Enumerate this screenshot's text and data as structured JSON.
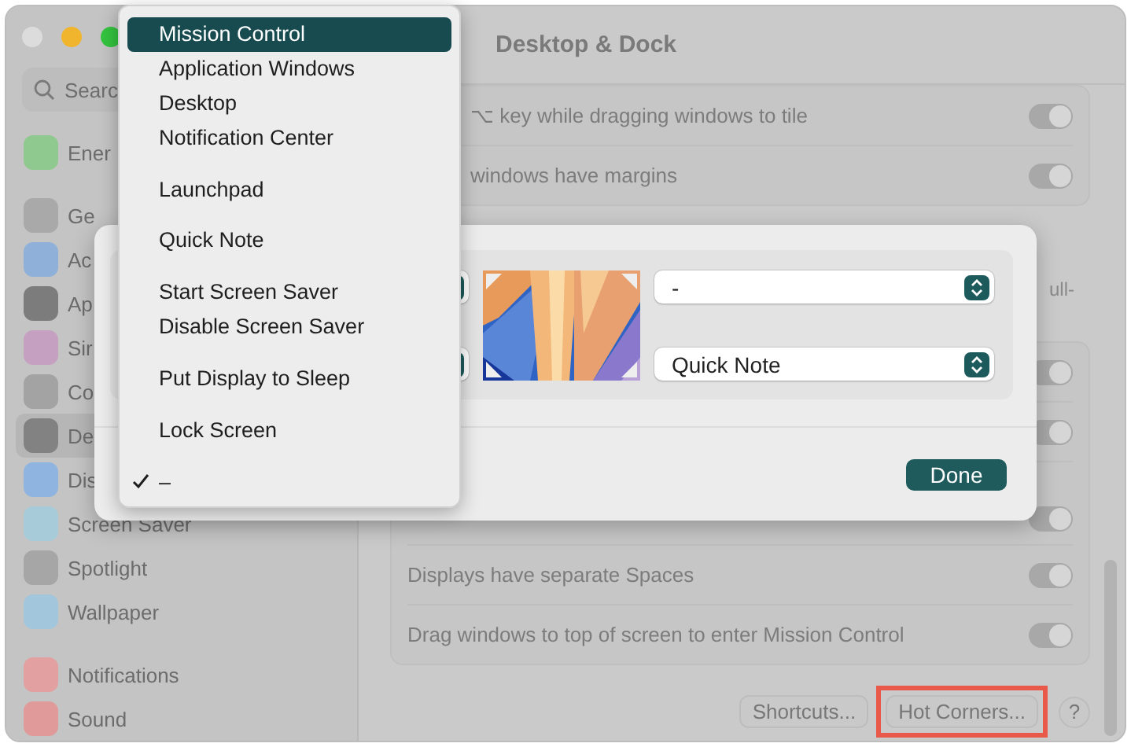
{
  "window": {
    "title": "Desktop & Dock"
  },
  "sidebar": {
    "search": {
      "placeholder": "Searc"
    },
    "groups": [
      [
        {
          "label": "Ener",
          "color": "#8fc98f",
          "selected": false
        }
      ],
      [
        {
          "label": "Ge",
          "color": "#a9a9a9",
          "selected": false
        },
        {
          "label": "Ac",
          "color": "#8fb0d8",
          "selected": false
        },
        {
          "label": "Ap",
          "color": "#7c7c7c",
          "selected": false
        },
        {
          "label": "Sir",
          "color": "#c5a0c0",
          "selected": false
        },
        {
          "label": "Co",
          "color": "#a3a3a3",
          "selected": false
        },
        {
          "label": "De",
          "color": "#828282",
          "selected": true
        },
        {
          "label": "Dis",
          "color": "#8fb4e0",
          "selected": false
        },
        {
          "label": "Screen Saver",
          "color": "#a7cbd8",
          "selected": false
        },
        {
          "label": "Spotlight",
          "color": "#a6a6a6",
          "selected": false
        },
        {
          "label": "Wallpaper",
          "color": "#a2c6dc",
          "selected": false
        }
      ],
      [
        {
          "label": "Notifications",
          "color": "#e2a0a0",
          "selected": false
        },
        {
          "label": "Sound",
          "color": "#e09a9a",
          "selected": false
        }
      ]
    ]
  },
  "settings_top": [
    {
      "label": "⌥ key while dragging windows to tile",
      "on": true
    },
    {
      "label": "windows have margins",
      "on": true
    }
  ],
  "note": "ull-",
  "settings": [
    {
      "on": true
    },
    {
      "on": true
    },
    {
      "on": true
    },
    {
      "label": "Displays have separate Spaces",
      "on": true
    },
    {
      "label": "Drag windows to top of screen to enter Mission Control",
      "on": true
    }
  ],
  "buttons": [
    {
      "label": "Shortcuts...",
      "highlighted": false
    },
    {
      "label": "Hot Corners...",
      "highlighted": true
    }
  ],
  "help": "?",
  "sheet": {
    "corners": [
      {
        "value": "-"
      },
      {
        "value": "Quick Note"
      }
    ],
    "done": "Done"
  },
  "menu": {
    "items": [
      {
        "kind": "item",
        "label": "Mission Control",
        "selected": true,
        "checked": false
      },
      {
        "kind": "item",
        "label": "Application Windows",
        "selected": false,
        "checked": false
      },
      {
        "kind": "item",
        "label": "Desktop",
        "selected": false,
        "checked": false
      },
      {
        "kind": "item",
        "label": "Notification Center",
        "selected": false,
        "checked": false
      },
      {
        "kind": "separator"
      },
      {
        "kind": "item",
        "label": "Launchpad",
        "selected": false,
        "checked": false
      },
      {
        "kind": "separator"
      },
      {
        "kind": "item",
        "label": "Quick Note",
        "selected": false,
        "checked": false
      },
      {
        "kind": "separator"
      },
      {
        "kind": "item",
        "label": "Start Screen Saver",
        "selected": false,
        "checked": false
      },
      {
        "kind": "item",
        "label": "Disable Screen Saver",
        "selected": false,
        "checked": false
      },
      {
        "kind": "separator"
      },
      {
        "kind": "item",
        "label": "Put Display to Sleep",
        "selected": false,
        "checked": false
      },
      {
        "kind": "separator"
      },
      {
        "kind": "item",
        "label": "Lock Screen",
        "selected": false,
        "checked": false
      },
      {
        "kind": "separator"
      },
      {
        "kind": "item",
        "label": "–",
        "selected": false,
        "checked": true
      }
    ]
  }
}
